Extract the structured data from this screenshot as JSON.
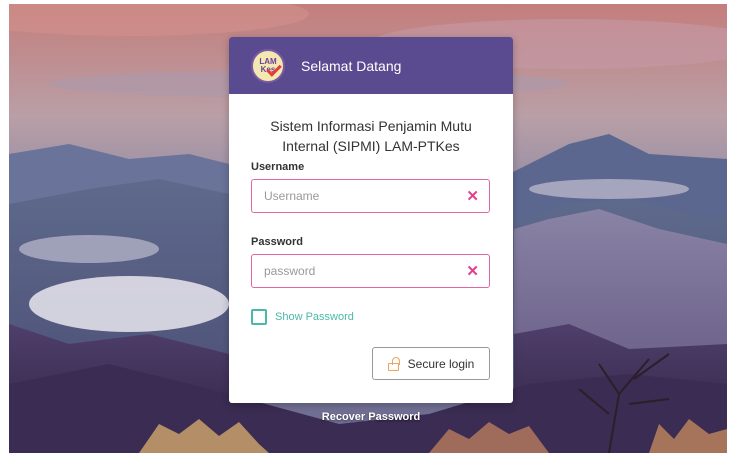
{
  "header": {
    "title": "Selamat Datang",
    "logo_text": "LAM Kes"
  },
  "form": {
    "system_title": "Sistem Informasi Penjamin Mutu Internal (SIPMI) LAM-PTKes",
    "username_label": "Username",
    "username_placeholder": "Username",
    "password_label": "Password",
    "password_placeholder": "password",
    "show_password_label": "Show Password",
    "login_label": "Secure login"
  },
  "footer": {
    "recover_label": "Recover Password"
  },
  "colors": {
    "header": "#5a4a8f",
    "field_border": "#e266a3",
    "clear_icon": "#e2408f",
    "checkbox": "#4bb8a9",
    "lock_icon": "#f0a35a"
  },
  "icons": {
    "clear": "close-icon",
    "login": "unlock-icon"
  }
}
